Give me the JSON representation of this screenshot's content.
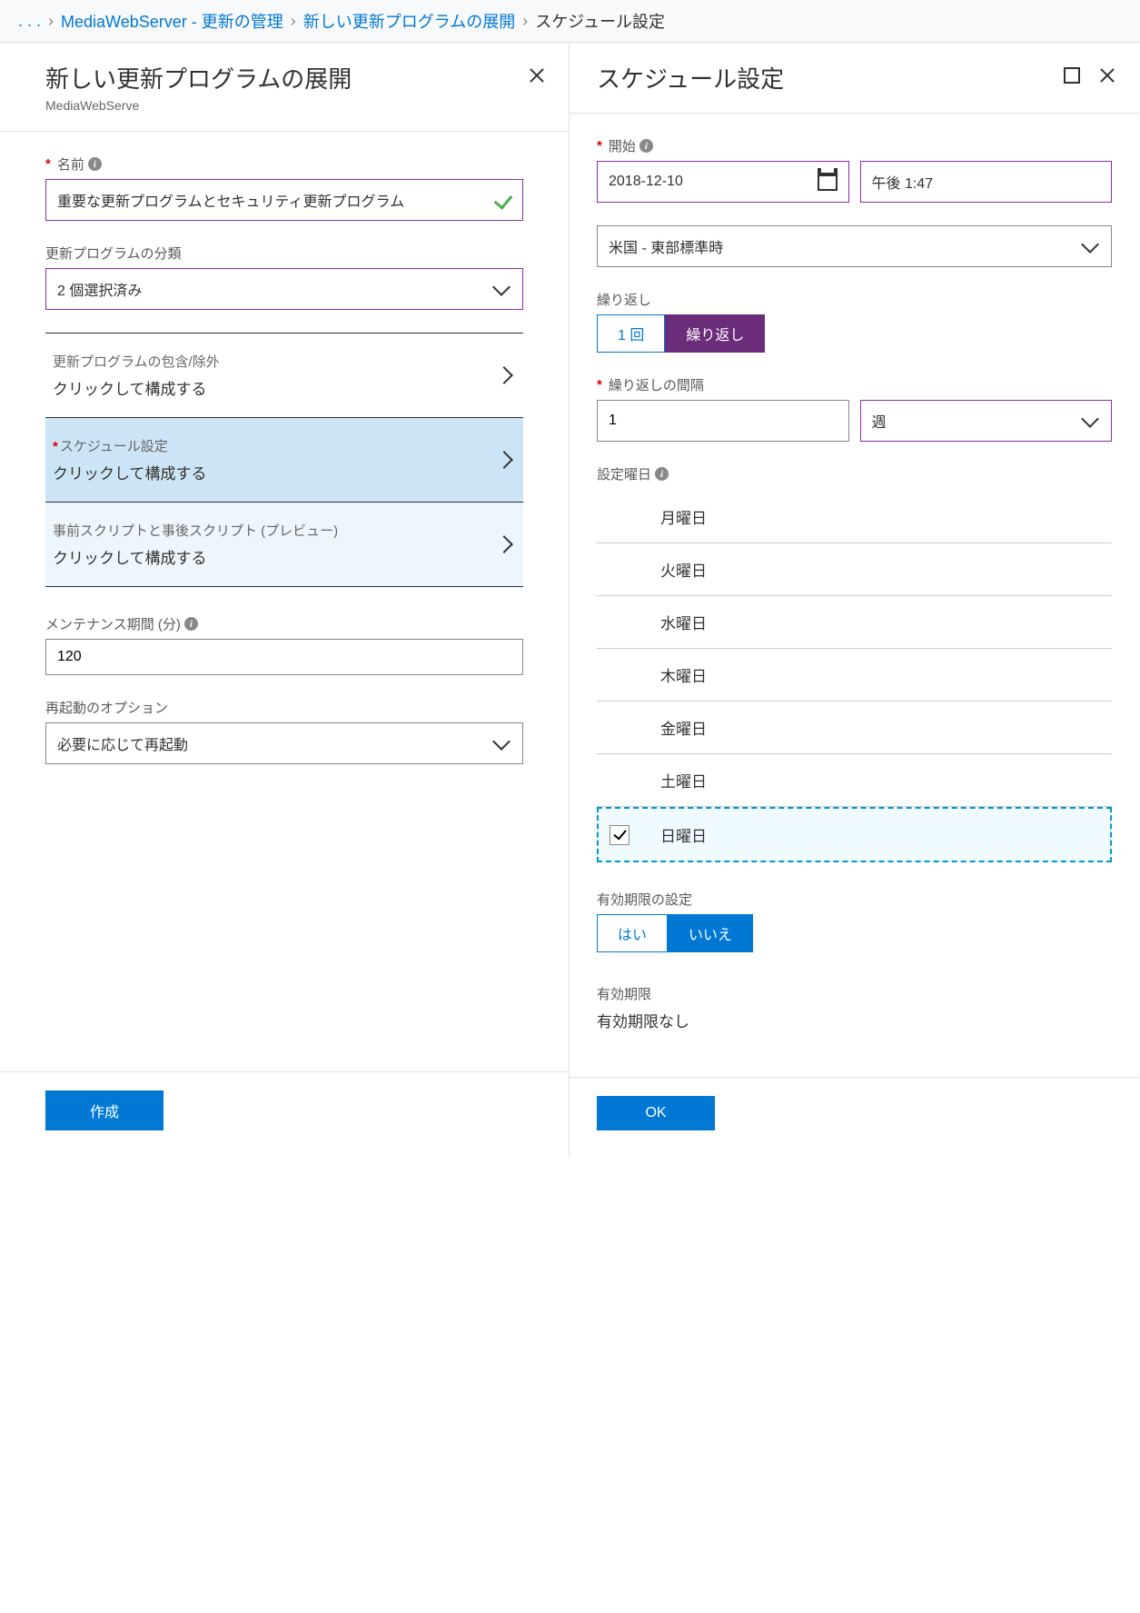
{
  "breadcrumb": {
    "item1": "MediaWebServer - 更新の管理",
    "item2": "新しい更新プログラムの展開",
    "current": "スケジュール設定"
  },
  "left": {
    "title": "新しい更新プログラムの展開",
    "subtitle": "MediaWebServe",
    "name_label": "名前",
    "name_value": "重要な更新プログラムとセキュリティ更新プログラム",
    "class_label": "更新プログラムの分類",
    "class_value": "2 個選択済み",
    "sec1_label": "更新プログラムの包含/除外",
    "sec1_sub": "クリックして構成する",
    "sec2_label": "スケジュール設定",
    "sec2_sub": "クリックして構成する",
    "sec3_label": "事前スクリプトと事後スクリプト (プレビュー)",
    "sec3_sub": "クリックして構成する",
    "maint_label": "メンテナンス期間 (分)",
    "maint_value": "120",
    "reboot_label": "再起動のオプション",
    "reboot_value": "必要に応じて再起動",
    "create_btn": "作成"
  },
  "right": {
    "title": "スケジュール設定",
    "start_label": "開始",
    "start_date": "2018-12-10",
    "start_time": "午後 1:47",
    "timezone": "米国 - 東部標準時",
    "repeat_label": "繰り返し",
    "repeat_once": "1 回",
    "repeat_recur": "繰り返し",
    "interval_label": "繰り返しの間隔",
    "interval_value": "1",
    "interval_unit": "週",
    "days_label": "設定曜日",
    "days": {
      "mon": "月曜日",
      "tue": "火曜日",
      "wed": "水曜日",
      "thu": "木曜日",
      "fri": "金曜日",
      "sat": "土曜日",
      "sun": "日曜日"
    },
    "expiry_set_label": "有効期限の設定",
    "yes": "はい",
    "no": "いいえ",
    "expiry_label": "有効期限",
    "expiry_value": "有効期限なし",
    "ok_btn": "OK"
  }
}
